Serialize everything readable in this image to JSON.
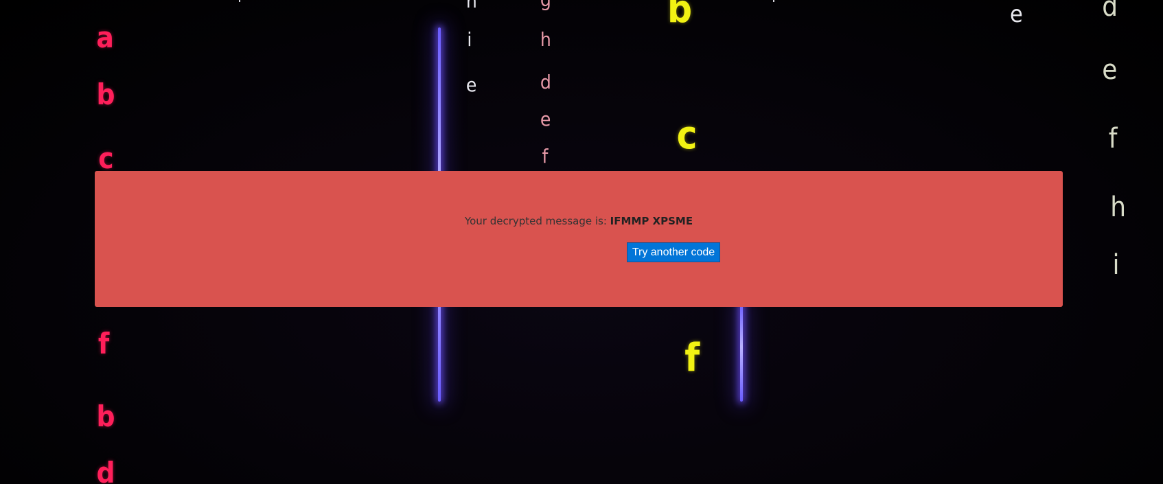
{
  "message": {
    "prefix": "Your decrypted message is:",
    "value": "IFMMP XPSME"
  },
  "actions": {
    "retry_label": "Try another code"
  },
  "background": {
    "glyphs": [
      "a",
      "b",
      "c",
      "f",
      "b",
      "d",
      "h",
      "i",
      "e",
      "g",
      "h",
      "d",
      "e",
      "f",
      "b",
      "c",
      "f",
      "e",
      "d",
      "e",
      "f",
      "h",
      "i",
      "i",
      "i"
    ],
    "colors": {
      "panel": "#d9534f",
      "button": "#0275d8",
      "pink": "#ff1f5a",
      "yellow": "#f2f213",
      "glow": "#6a5cff"
    }
  }
}
